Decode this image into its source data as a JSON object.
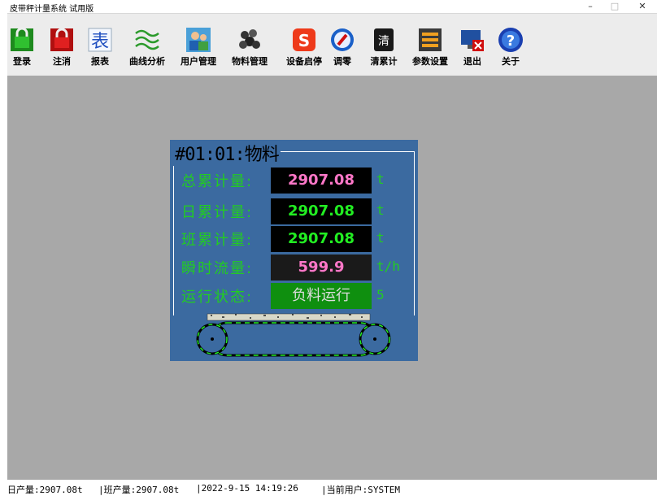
{
  "window": {
    "title": "皮带秤计量系统 试用版",
    "minimize": "–",
    "maximize": "□",
    "close": "✕"
  },
  "toolbar": {
    "items": [
      {
        "label": "登录",
        "icon": "login-icon"
      },
      {
        "label": "注消",
        "icon": "logout-lock-icon"
      },
      {
        "label": "报表",
        "icon": "report-icon"
      },
      {
        "label": "曲线分析",
        "icon": "curve-icon"
      },
      {
        "label": "用户管理",
        "icon": "users-icon"
      },
      {
        "label": "物料管理",
        "icon": "material-icon"
      },
      {
        "label": "设备启停",
        "icon": "power-icon"
      },
      {
        "label": "调零",
        "icon": "zero-icon"
      },
      {
        "label": "清累计",
        "icon": "clear-icon"
      },
      {
        "label": "参数设置",
        "icon": "settings-icon"
      },
      {
        "label": "退出",
        "icon": "exit-icon"
      },
      {
        "label": "关于",
        "icon": "about-icon"
      }
    ]
  },
  "panel": {
    "title": "#01:01:物料",
    "rows": [
      {
        "label": "总累计量:",
        "value": "2907.08",
        "unit": "t",
        "value_color": "#ff77c8",
        "box_color": "#000000"
      },
      {
        "label": "日累计量:",
        "value": "2907.08",
        "unit": "t",
        "value_color": "#22ee22",
        "box_color": "#000000"
      },
      {
        "label": "班累计量:",
        "value": "2907.08",
        "unit": "t",
        "value_color": "#22ee22",
        "box_color": "#000000"
      },
      {
        "label": "瞬时流量:",
        "value": "599.9",
        "unit": "t/h",
        "value_color": "#ff77c8",
        "box_color": "#1a1a1a"
      },
      {
        "label": "运行状态:",
        "value": "负料运行",
        "unit": "5",
        "value_color": "#dddddd",
        "box_color": "#0f8f0f"
      }
    ]
  },
  "status": {
    "daily": "日产量:2907.08t",
    "shift": "|班产量:2907.08t",
    "datetime": "|2022-9-15 14:19:26",
    "user": "|当前用户:SYSTEM"
  },
  "colors": {
    "workspace": "#a8a8a8",
    "panel": "#3b6aa0",
    "label_green": "#22cc22"
  }
}
